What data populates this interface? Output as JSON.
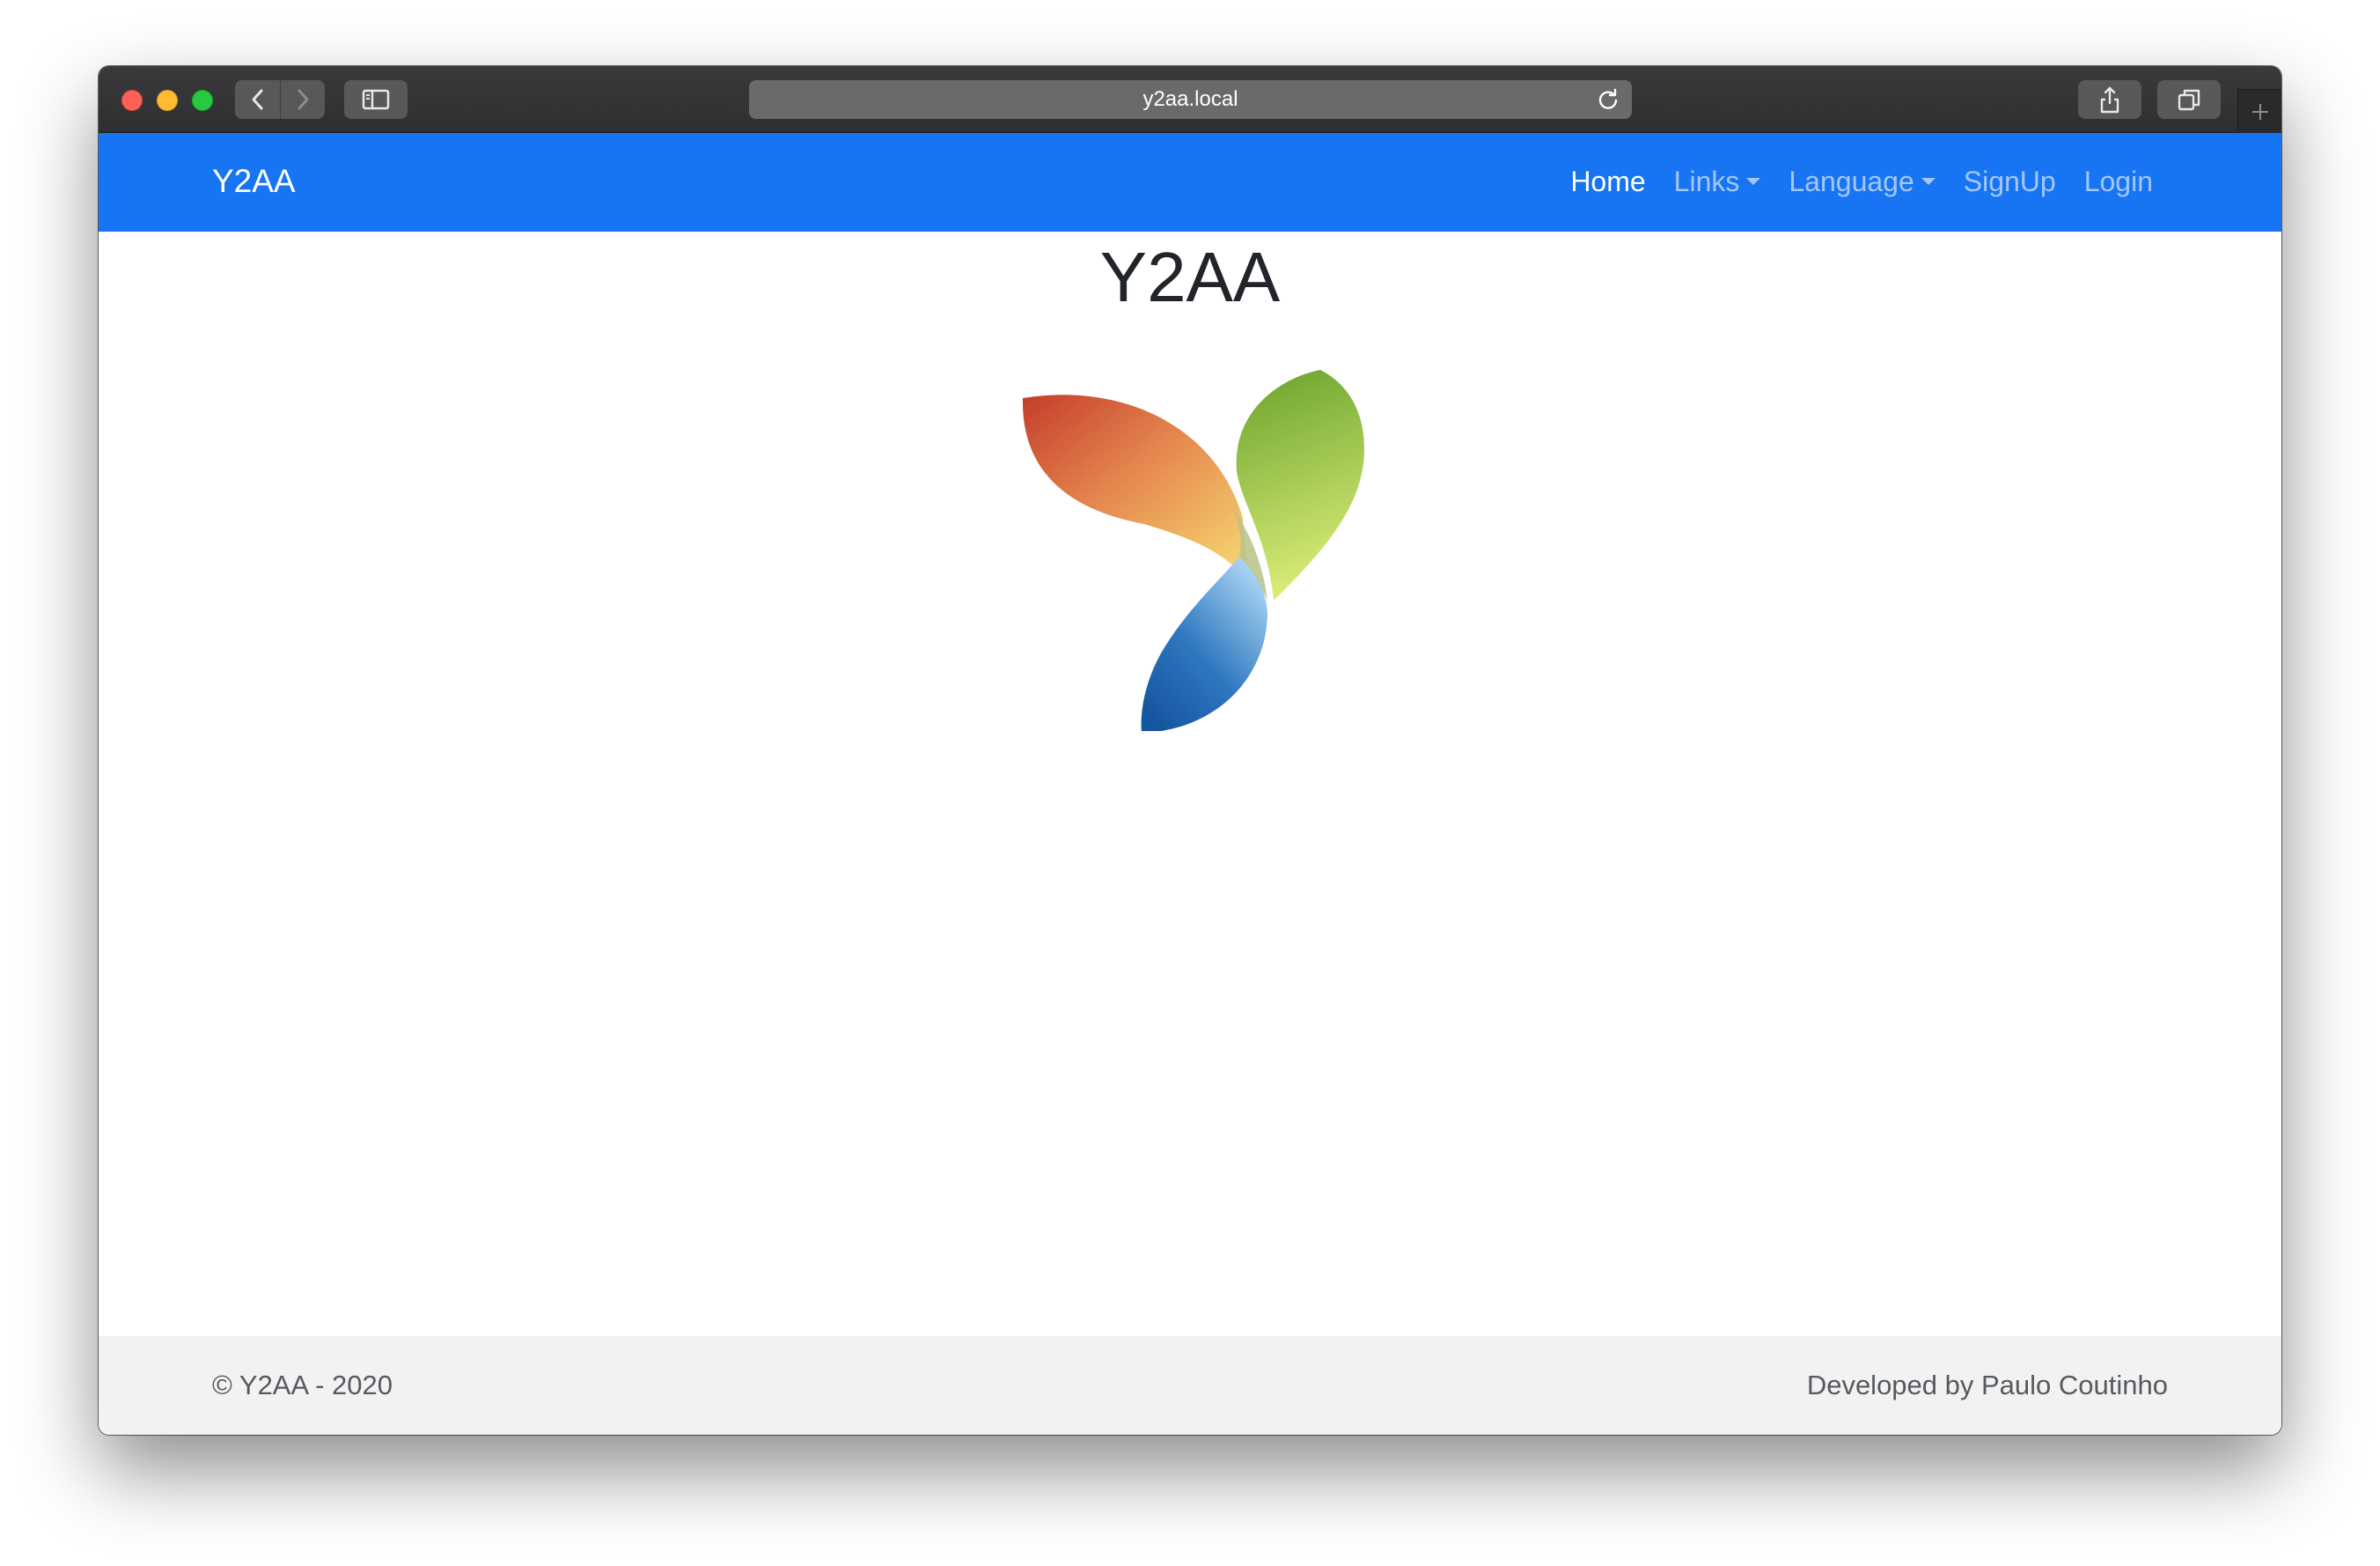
{
  "browser": {
    "address_url": "y2aa.local"
  },
  "navbar": {
    "brand": "Y2AA",
    "links": [
      {
        "label": "Home"
      },
      {
        "label": "Links"
      },
      {
        "label": "Language"
      },
      {
        "label": "SignUp"
      },
      {
        "label": "Login"
      }
    ]
  },
  "main": {
    "title": "Y2AA"
  },
  "footer": {
    "copyright": "© Y2AA - 2020",
    "credit": "Developed by Paulo Coutinho"
  },
  "colors": {
    "navbar_bg": "#1774f3",
    "footer_bg": "#f2f2f2"
  }
}
